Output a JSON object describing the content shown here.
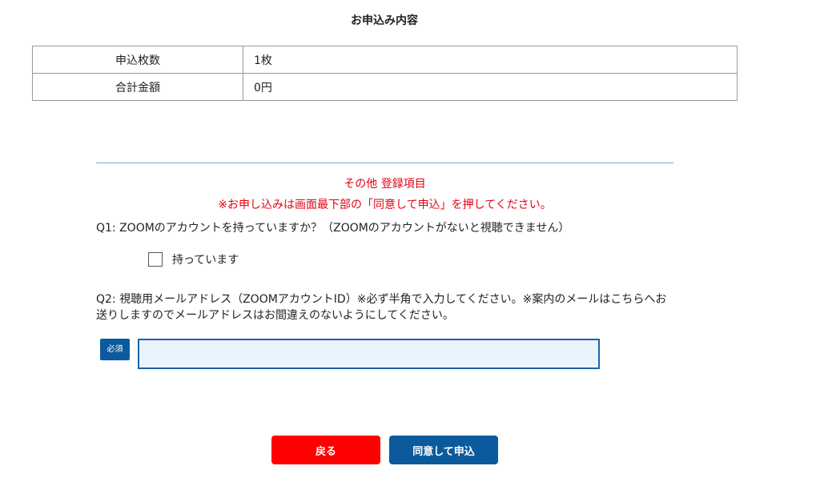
{
  "summary": {
    "title": "お申込み内容",
    "rows": [
      {
        "label": "申込枚数",
        "value": "1枚"
      },
      {
        "label": "合計金額",
        "value": "0円"
      }
    ]
  },
  "other": {
    "title": "その他 登録項目",
    "note": "※お申し込みは画面最下部の「同意して申込」を押してください。"
  },
  "q1": {
    "text": "Q1: ZOOMのアカウントを持っていますか？（ZOOMのアカウントがないと視聴できません）",
    "option_label": "持っています"
  },
  "q2": {
    "text": "Q2: 視聴用メールアドレス（ZOOMアカウントID）※必ず半角で入力してください。※案内のメールはこちらへお送りしますのでメールアドレスはお間違えのないようにしてください。",
    "required_label": "必須",
    "value": ""
  },
  "buttons": {
    "back_label": "戻る",
    "submit_label": "同意して申込"
  },
  "colors": {
    "accent_red": "#e60012",
    "primary_blue": "#0b5a9e",
    "input_bg": "#e9f4fc"
  }
}
